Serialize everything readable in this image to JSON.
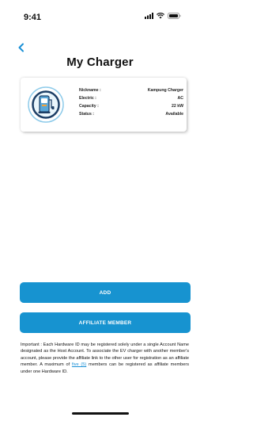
{
  "status_bar": {
    "time": "9:41"
  },
  "header": {
    "back_icon": "chevron-left-icon",
    "title": "My Charger"
  },
  "charger": {
    "icon": "ev-charger-icon",
    "fields": [
      {
        "label": "Nickname :",
        "value": "Kampung Charger"
      },
      {
        "label": "Electric :",
        "value": "AC"
      },
      {
        "label": "Capacity :",
        "value": "22 kW"
      },
      {
        "label": "Status :",
        "value": "Available"
      }
    ]
  },
  "actions": {
    "add_label": "ADD",
    "affiliate_label": "AFFILIATE MEMBER"
  },
  "note": {
    "text_before": "Important : Each Hardware ID may be registered solely under a single Account Name designated as the Host Account. To associate the EV charger with another member's account, please provide the affiliate link to the other user for registration as an affiliate member. A maximum of ",
    "link_text": "five (5)",
    "text_after": " members can be registered as affiliate members under one Hardware ID."
  },
  "colors": {
    "accent": "#1793d0"
  }
}
